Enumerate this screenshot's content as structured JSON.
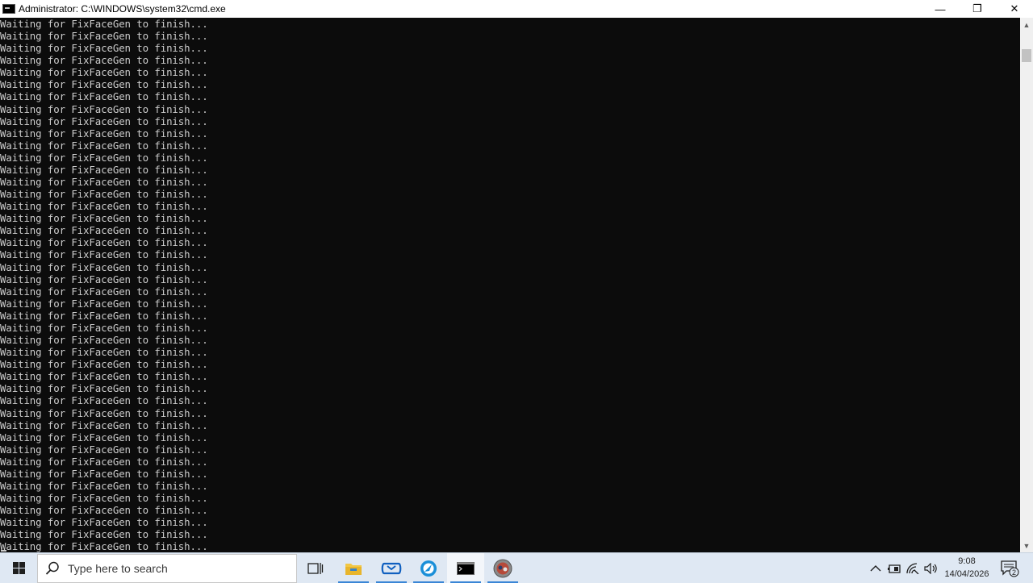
{
  "window": {
    "title": "Administrator: C:\\WINDOWS\\system32\\cmd.exe",
    "minimize_glyph": "—",
    "restore_glyph": "❐",
    "close_glyph": "✕"
  },
  "console": {
    "lines": [
      "Waiting for FixFaceGen to finish...",
      "Waiting for FixFaceGen to finish...",
      "Waiting for FixFaceGen to finish...",
      "Waiting for FixFaceGen to finish...",
      "Waiting for FixFaceGen to finish...",
      "Waiting for FixFaceGen to finish...",
      "Waiting for FixFaceGen to finish...",
      "Waiting for FixFaceGen to finish...",
      "Waiting for FixFaceGen to finish...",
      "Waiting for FixFaceGen to finish...",
      "Waiting for FixFaceGen to finish...",
      "Waiting for FixFaceGen to finish...",
      "Waiting for FixFaceGen to finish...",
      "Waiting for FixFaceGen to finish...",
      "Waiting for FixFaceGen to finish...",
      "Waiting for FixFaceGen to finish...",
      "Waiting for FixFaceGen to finish...",
      "Waiting for FixFaceGen to finish...",
      "Waiting for FixFaceGen to finish...",
      "Waiting for FixFaceGen to finish...",
      "Waiting for FixFaceGen to finish...",
      "Waiting for FixFaceGen to finish...",
      "Waiting for FixFaceGen to finish...",
      "Waiting for FixFaceGen to finish...",
      "Waiting for FixFaceGen to finish...",
      "Waiting for FixFaceGen to finish...",
      "Waiting for FixFaceGen to finish...",
      "Waiting for FixFaceGen to finish...",
      "Waiting for FixFaceGen to finish...",
      "Waiting for FixFaceGen to finish...",
      "Waiting for FixFaceGen to finish...",
      "Waiting for FixFaceGen to finish...",
      "Waiting for FixFaceGen to finish...",
      "Waiting for FixFaceGen to finish...",
      "Waiting for FixFaceGen to finish...",
      "Waiting for FixFaceGen to finish...",
      "Waiting for FixFaceGen to finish...",
      "Waiting for FixFaceGen to finish...",
      "Waiting for FixFaceGen to finish...",
      "Waiting for FixFaceGen to finish...",
      "Waiting for FixFaceGen to finish...",
      "Waiting for FixFaceGen to finish...",
      "Waiting for FixFaceGen to finish...",
      "Waiting for FixFaceGen to finish..."
    ],
    "text_color": "#cccccc",
    "background_color": "#0c0c0c"
  },
  "scrollbar": {
    "up_glyph": "▲",
    "down_glyph": "▼"
  },
  "taskbar": {
    "search_placeholder": "Type here to search",
    "icons": [
      "task-view-icon",
      "file-explorer-icon",
      "mail-icon",
      "browser-icon",
      "command-prompt-icon",
      "app-icon"
    ],
    "accent_color": "#3a86d6"
  },
  "tray": {
    "chevron_glyph": "^",
    "time": "9:08",
    "date": "14/04/2026",
    "notification_count": "2"
  }
}
